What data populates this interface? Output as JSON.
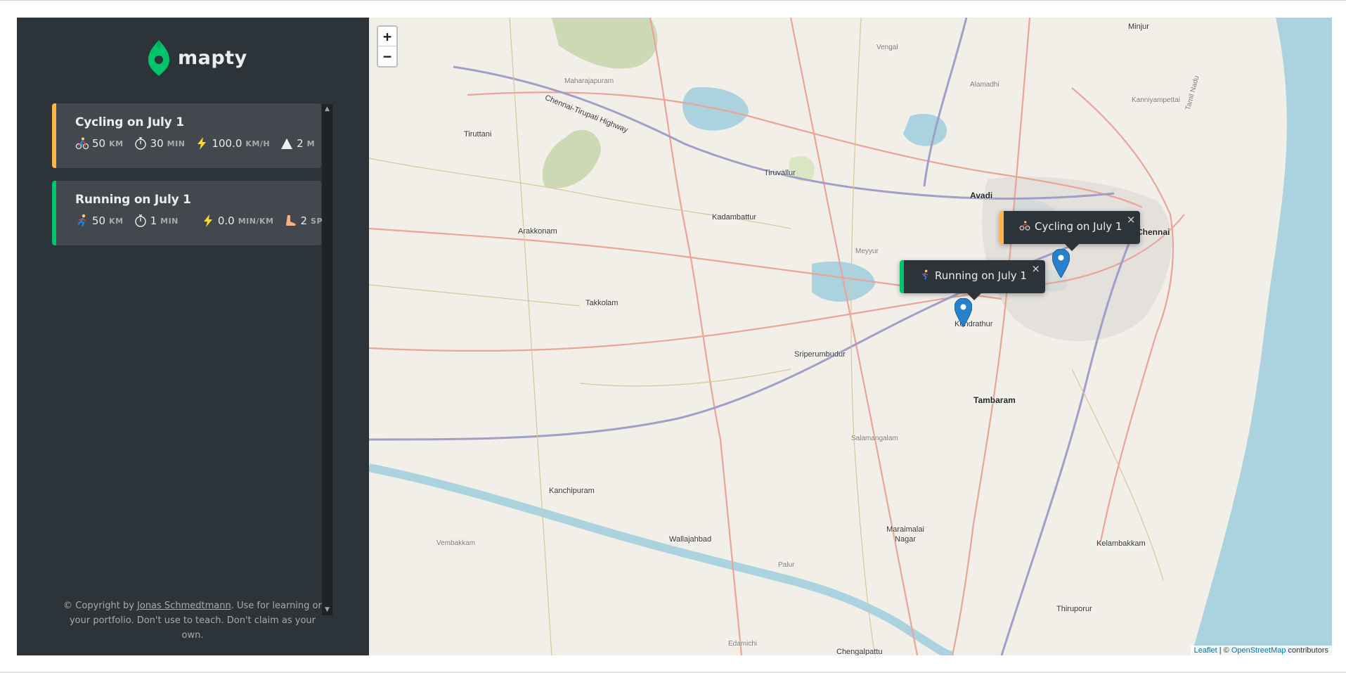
{
  "app": {
    "name": "mapty"
  },
  "workouts": [
    {
      "title": "Cycling on July 1",
      "type": "cycling",
      "accent": "#ffb545",
      "details": [
        {
          "icon": "cyclist-icon",
          "value": "50",
          "unit": "km"
        },
        {
          "icon": "stopwatch-icon",
          "value": "30",
          "unit": "min"
        },
        {
          "icon": "lightning-icon",
          "value": "100.0",
          "unit": "km/h"
        },
        {
          "icon": "mountain-icon",
          "value": "2",
          "unit": "m"
        }
      ]
    },
    {
      "title": "Running on July 1",
      "type": "running",
      "accent": "#00c46a",
      "details": [
        {
          "icon": "runner-icon",
          "value": "50",
          "unit": "km"
        },
        {
          "icon": "stopwatch-icon",
          "value": "1",
          "unit": "min"
        },
        {
          "icon": "lightning-icon",
          "value": "0.0",
          "unit": "min/km"
        },
        {
          "icon": "foot-icon",
          "value": "2",
          "unit": "spm"
        }
      ]
    }
  ],
  "footer": {
    "prefix": "© Copyright by ",
    "author": "Jonas Schmedtmann",
    "suffix": ". Use for learning or your portfolio. Don't use to teach. Don't claim as your own."
  },
  "map": {
    "zoom_in": "+",
    "zoom_out": "−",
    "popups": [
      {
        "label": "Cycling on July 1",
        "type": "cycling",
        "close": "×"
      },
      {
        "label": "Running on July 1",
        "type": "running",
        "close": "×"
      }
    ],
    "attribution": {
      "leaflet": "Leaflet",
      "sep": " | © ",
      "osm": "OpenStreetMap",
      "tail": " contributors"
    },
    "place_labels": [
      "Minjur",
      "Vengal",
      "Maharajapuram",
      "Chennai-Tirupati Highway",
      "Alamadhi",
      "Kanniyampettai",
      "Tiruttani",
      "Tiruvallur",
      "Avadi",
      "Arakkonam",
      "Kadambattur",
      "Chennai",
      "Meyyur",
      "Takkolam",
      "Kundrathur",
      "Sriperumbudur",
      "Tambaram",
      "Salamangalam",
      "Kanchipuram",
      "Vembakkam",
      "Wallajahbad",
      "Maraimalai Nagar",
      "Kelambakkam",
      "Palur",
      "Thiruporur",
      "Edamichi",
      "Chengalpattu",
      "Tamil Nadu"
    ]
  }
}
